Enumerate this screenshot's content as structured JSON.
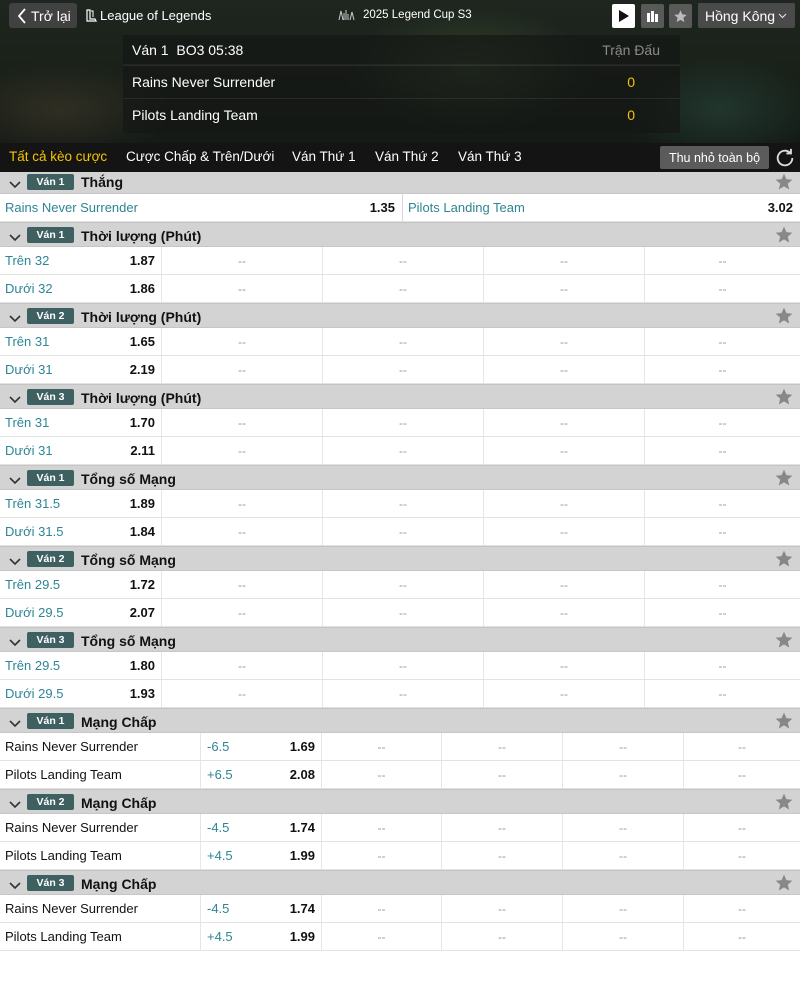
{
  "header": {
    "back_label": "Trở lại",
    "game_name": "League of Legends",
    "tournament": "2025 Legend Cup S3",
    "region": "Hồng Kông"
  },
  "scoreboard": {
    "info": "Ván 1  BO3 05:38",
    "column_header": "Trận Đấu",
    "teams": [
      {
        "name": "Rains Never Surrender",
        "score": "0"
      },
      {
        "name": "Pilots Landing Team",
        "score": "0"
      }
    ]
  },
  "tabs": [
    {
      "label": "Tất cả kèo cược",
      "active": true
    },
    {
      "label": "Cược Chấp & Trên/Dưới",
      "active": false
    },
    {
      "label": "Ván Thứ 1",
      "active": false
    },
    {
      "label": "Ván Thứ 2",
      "active": false
    },
    {
      "label": "Ván Thứ 3",
      "active": false
    }
  ],
  "collapse_label": "Thu nhỏ toàn bộ",
  "empty_cell": "--",
  "win_market": {
    "badge": "Ván 1",
    "title": "Thắng",
    "home": {
      "team": "Rains Never Surrender",
      "odds": "1.35"
    },
    "away": {
      "team": "Pilots Landing Team",
      "odds": "3.02"
    }
  },
  "ou_markets": [
    {
      "badge": "Ván 1",
      "title": "Thời lượng (Phút)",
      "rows": [
        {
          "label": "Trên 32",
          "odds": "1.87"
        },
        {
          "label": "Dưới 32",
          "odds": "1.86"
        }
      ]
    },
    {
      "badge": "Ván 2",
      "title": "Thời lượng (Phút)",
      "rows": [
        {
          "label": "Trên 31",
          "odds": "1.65"
        },
        {
          "label": "Dưới 31",
          "odds": "2.19"
        }
      ]
    },
    {
      "badge": "Ván 3",
      "title": "Thời lượng (Phút)",
      "rows": [
        {
          "label": "Trên 31",
          "odds": "1.70"
        },
        {
          "label": "Dưới 31",
          "odds": "2.11"
        }
      ]
    },
    {
      "badge": "Ván 1",
      "title": "Tổng số Mạng",
      "rows": [
        {
          "label": "Trên 31.5",
          "odds": "1.89"
        },
        {
          "label": "Dưới 31.5",
          "odds": "1.84"
        }
      ]
    },
    {
      "badge": "Ván 2",
      "title": "Tổng số Mạng",
      "rows": [
        {
          "label": "Trên 29.5",
          "odds": "1.72"
        },
        {
          "label": "Dưới 29.5",
          "odds": "2.07"
        }
      ]
    },
    {
      "badge": "Ván 3",
      "title": "Tổng số Mạng",
      "rows": [
        {
          "label": "Trên 29.5",
          "odds": "1.80"
        },
        {
          "label": "Dưới 29.5",
          "odds": "1.93"
        }
      ]
    }
  ],
  "hcp_markets": [
    {
      "badge": "Ván 1",
      "title": "Mạng Chấp",
      "rows": [
        {
          "team": "Rains Never Surrender",
          "line": "-6.5",
          "odds": "1.69"
        },
        {
          "team": "Pilots Landing Team",
          "line": "+6.5",
          "odds": "2.08"
        }
      ]
    },
    {
      "badge": "Ván 2",
      "title": "Mạng Chấp",
      "rows": [
        {
          "team": "Rains Never Surrender",
          "line": "-4.5",
          "odds": "1.74"
        },
        {
          "team": "Pilots Landing Team",
          "line": "+4.5",
          "odds": "1.99"
        }
      ]
    },
    {
      "badge": "Ván 3",
      "title": "Mạng Chấp",
      "rows": [
        {
          "team": "Rains Never Surrender",
          "line": "-4.5",
          "odds": "1.74"
        },
        {
          "team": "Pilots Landing Team",
          "line": "+4.5",
          "odds": "1.99"
        }
      ]
    }
  ],
  "colors": {
    "accent": "#f5c400",
    "teal_text": "#2d8595",
    "badge": "#3f6061",
    "header_bg": "#d3d3d3"
  }
}
